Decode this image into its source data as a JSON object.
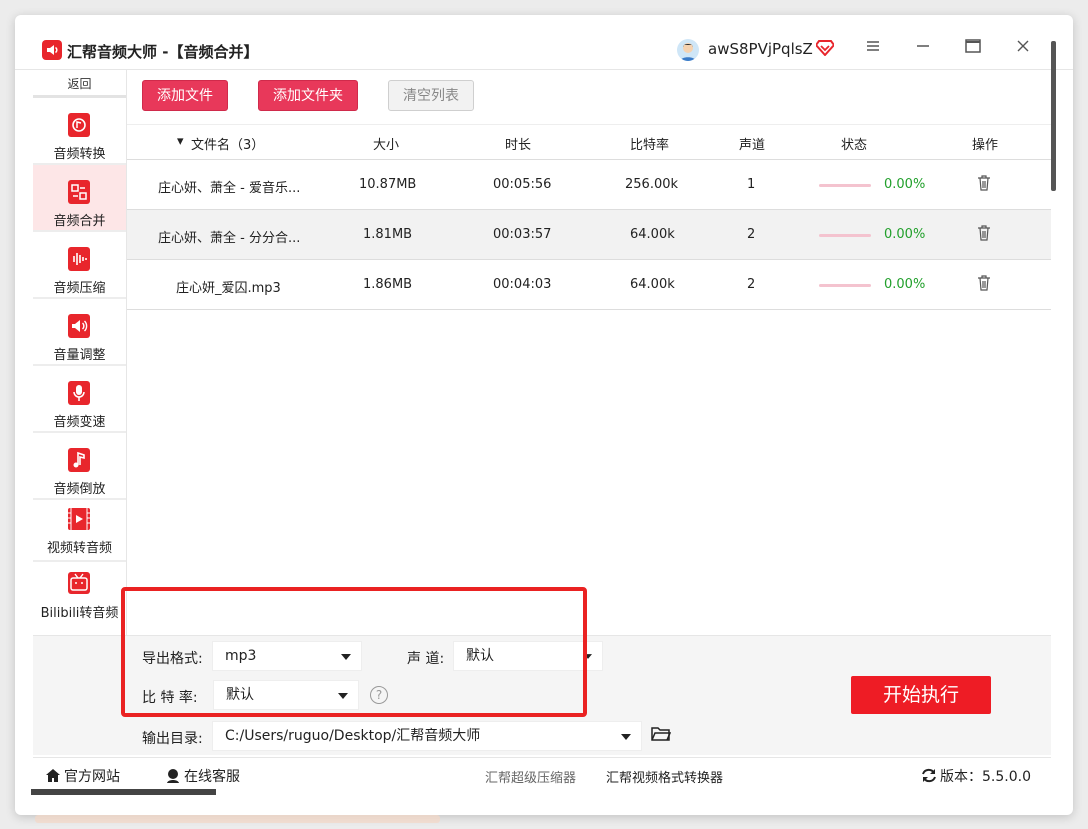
{
  "app": {
    "title": "汇帮音频大师 -【音频合并】",
    "username": "awS8PVjPqlsZ"
  },
  "sidebar": {
    "back_label": "返回",
    "items": [
      {
        "label": "音频转换",
        "icon": "audio-convert-icon"
      },
      {
        "label": "音频合并",
        "icon": "audio-merge-icon",
        "active": true
      },
      {
        "label": "音频压缩",
        "icon": "audio-compress-icon"
      },
      {
        "label": "音量调整",
        "icon": "volume-adjust-icon"
      },
      {
        "label": "音频变速",
        "icon": "audio-speed-icon"
      },
      {
        "label": "音频倒放",
        "icon": "audio-reverse-icon"
      },
      {
        "label": "视频转音频",
        "icon": "video-to-audio-icon"
      },
      {
        "label": "Bilibili转音频",
        "icon": "bilibili-icon"
      }
    ]
  },
  "toolbar": {
    "add_file": "添加文件",
    "add_folder": "添加文件夹",
    "clear_list": "清空列表"
  },
  "table": {
    "headers": {
      "filename": "文件名（3）",
      "size": "大小",
      "duration": "时长",
      "bitrate": "比特率",
      "channels": "声道",
      "status": "状态",
      "actions": "操作"
    },
    "rows": [
      {
        "name": "庄心妍、萧全 - 爱音乐...",
        "size": "10.87MB",
        "duration": "00:05:56",
        "bitrate": "256.00k",
        "channels": "1",
        "progress": "0.00%"
      },
      {
        "name": "庄心妍、萧全 - 分分合...",
        "size": "1.81MB",
        "duration": "00:03:57",
        "bitrate": "64.00k",
        "channels": "2",
        "progress": "0.00%"
      },
      {
        "name": "庄心妍_爱囚.mp3",
        "size": "1.86MB",
        "duration": "00:04:03",
        "bitrate": "64.00k",
        "channels": "2",
        "progress": "0.00%"
      }
    ]
  },
  "settings": {
    "format_label": "导出格式:",
    "format_value": "mp3",
    "channel_label": "声 道:",
    "channel_value": "默认",
    "bitrate_label": "比 特 率:",
    "bitrate_value": "默认",
    "help_glyph": "?",
    "output_label": "输出目录:",
    "output_value": "C:/Users/ruguo/Desktop/汇帮音频大师"
  },
  "start_button": "开始执行",
  "footer": {
    "website": "官方网站",
    "support": "在线客服",
    "link1": "汇帮超级压缩器",
    "link2": "汇帮视频格式转换器",
    "version": "版本：5.5.0.0"
  },
  "colors": {
    "accent_red": "#e8385a",
    "start_red": "#ee1c25",
    "progress_green": "#22a02c"
  }
}
